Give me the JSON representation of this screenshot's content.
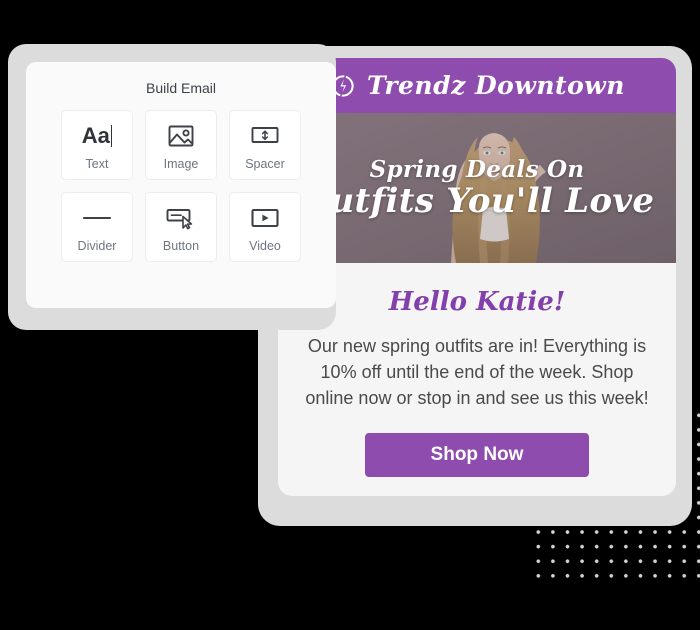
{
  "build_panel": {
    "title": "Build Email",
    "tiles": [
      {
        "label": "Text",
        "icon": "text-aa-icon",
        "glyph": "Aa"
      },
      {
        "label": "Image",
        "icon": "image-icon"
      },
      {
        "label": "Spacer",
        "icon": "spacer-icon"
      },
      {
        "label": "Divider",
        "icon": "divider-icon"
      },
      {
        "label": "Button",
        "icon": "button-cursor-icon"
      },
      {
        "label": "Video",
        "icon": "video-play-icon"
      }
    ]
  },
  "email": {
    "header": {
      "brand_name": "Trendz Downtown",
      "logo_icon": "lightning-bolt-circle-icon",
      "background_color": "#8d4cae",
      "text_color": "#ffffff"
    },
    "hero": {
      "line1": "Spring Deals On",
      "line2": "Outfits You'll Love",
      "background_color": "#7e6f77",
      "text_color": "#ffffff"
    },
    "greeting": "Hello Katie!",
    "greeting_color": "#8340ab",
    "body_text": "Our new spring outfits are in! Everything is 10% off until the end of the week. Shop online now or stop in and see us this week!",
    "cta": {
      "label": "Shop Now",
      "background_color": "#8d4cae",
      "text_color": "#ffffff"
    }
  },
  "decoration": {
    "dot_grid_color": "#d4d4d4",
    "canvas_background": "#000000",
    "card_shadow_color": "#dcdcdc"
  }
}
